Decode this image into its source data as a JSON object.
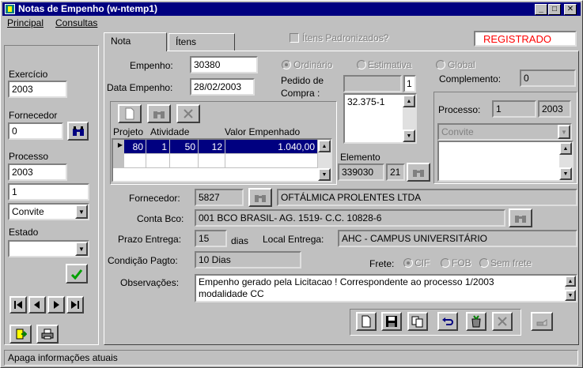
{
  "window": {
    "title": "Notas de Empenho  (w-ntemp1)"
  },
  "menu": {
    "items": [
      "Principal",
      "Consultas"
    ]
  },
  "left": {
    "exercicio_label": "Exercício",
    "exercicio_value": "2003",
    "fornecedor_label": "Fornecedor",
    "fornecedor_value": "0",
    "processo_label": "Processo",
    "processo_year": "2003",
    "processo_number": "1",
    "modalidade_value": "Convite",
    "estado_label": "Estado",
    "estado_value": ""
  },
  "tabs": {
    "nota": "Nota",
    "itens": "Ítens"
  },
  "header": {
    "itens_padronizados": "Ítens Padronizados?",
    "status": "REGISTRADO"
  },
  "empenho": {
    "label": "Empenho:",
    "value": "30380",
    "data_label": "Data Empenho:",
    "data_value": "28/02/2003",
    "tipo_options": [
      "Ordinário",
      "Estimativa",
      "Global"
    ]
  },
  "pedido": {
    "label_line1": "Pedido de",
    "label_line2": "Compra :",
    "count": "1",
    "list": [
      "32.375-1"
    ]
  },
  "complemento": {
    "label": "Complemento:",
    "value": "0"
  },
  "projetos": {
    "headers": [
      "Projeto",
      "Atividade",
      "Valor Empenhado"
    ],
    "rows": [
      {
        "c1": "80",
        "c2": "1",
        "c3": "50",
        "c4": "12",
        "valor": "1.040,00"
      }
    ]
  },
  "elemento": {
    "label": "Elemento",
    "value": "339030",
    "sub": "21"
  },
  "processo_box": {
    "label": "Processo:",
    "number": "1",
    "year": "2003",
    "modalidade": "Convite"
  },
  "fornecedor": {
    "label": "Fornecedor:",
    "code": "5827",
    "name": "OFTÁLMICA PROLENTES LTDA"
  },
  "conta": {
    "label": "Conta Bco:",
    "value": "001 BCO BRASIL- AG. 1519- C.C. 10828-6"
  },
  "prazo": {
    "label": "Prazo Entrega:",
    "value": "15",
    "unit": "dias"
  },
  "local": {
    "label": "Local Entrega:",
    "value": "AHC - CAMPUS UNIVERSITÁRIO"
  },
  "condicao": {
    "label": "Condição Pagto:",
    "value": "10  Dias"
  },
  "frete": {
    "label": "Frete:",
    "options": [
      "CIF",
      "FOB",
      "Sem frete"
    ]
  },
  "observacoes": {
    "label": "Observações:",
    "line1": "Empenho gerado pela Licitacao ! Correspondente ao processo 1/2003",
    "line2": "modalidade CC"
  },
  "status": {
    "text": "Apaga informações atuais"
  },
  "colors": {
    "title_bg": "#000080",
    "status_red": "#ff0000",
    "face": "#c0c0c0",
    "selection": "#000080"
  }
}
